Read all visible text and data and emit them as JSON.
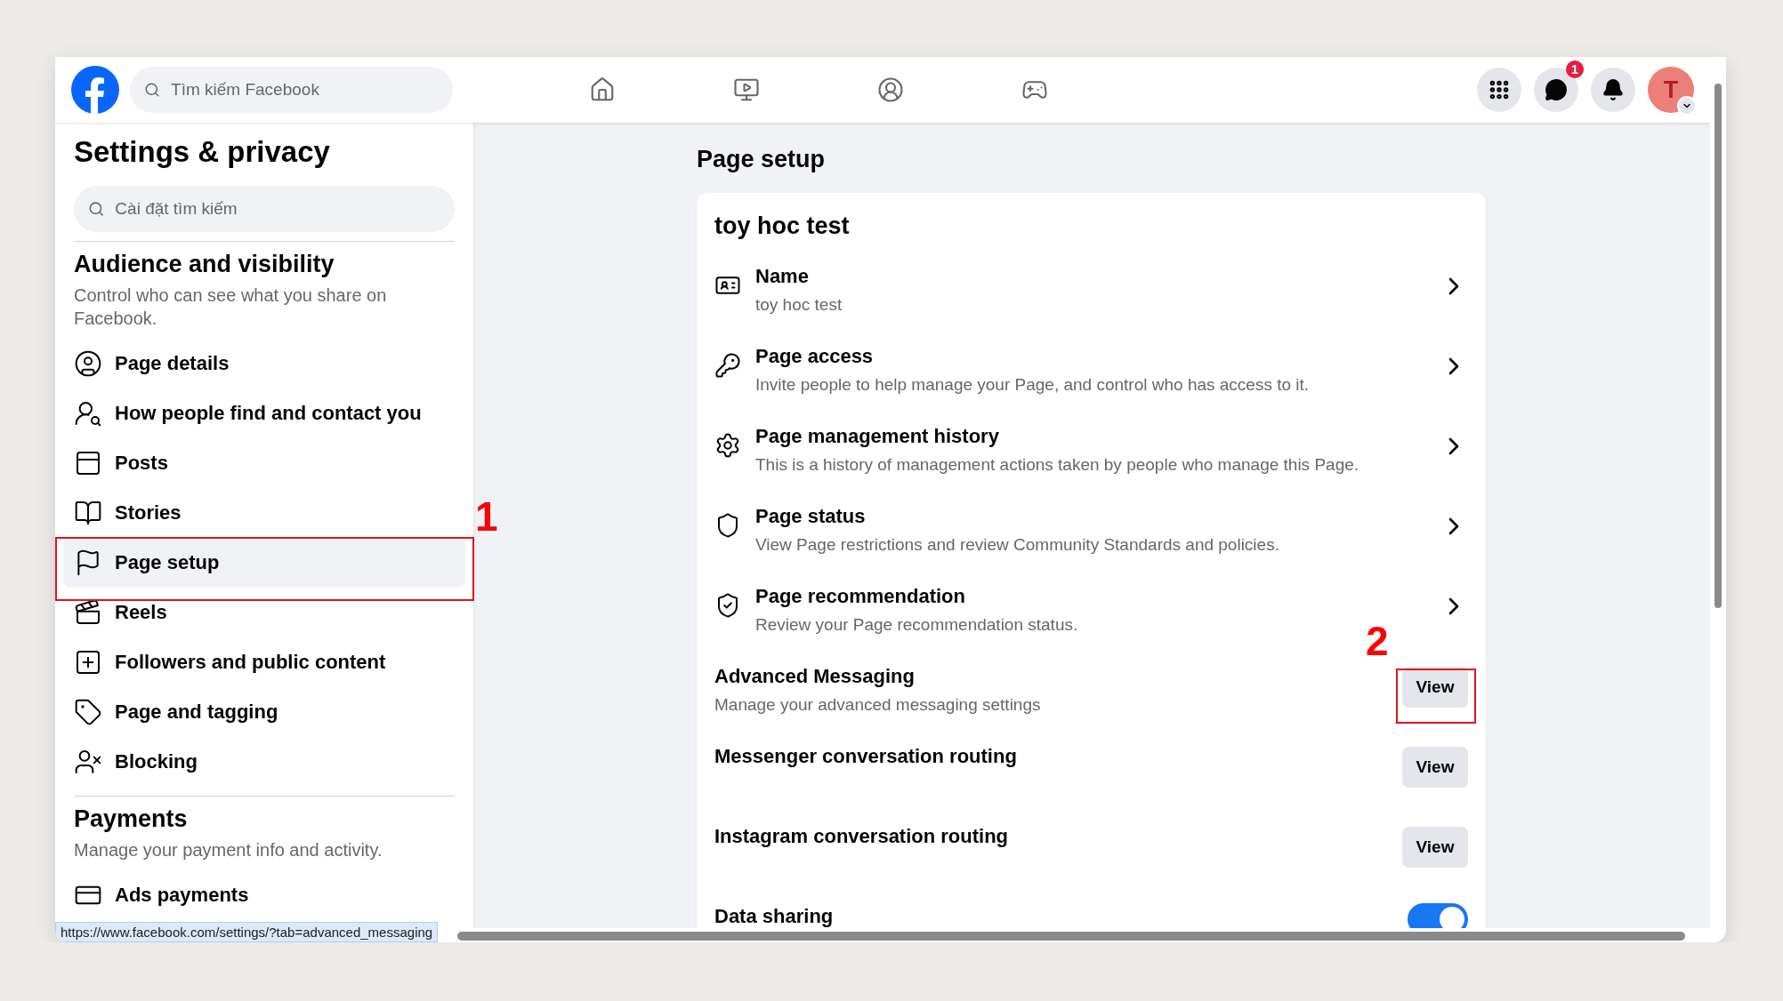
{
  "topbar": {
    "search": {
      "placeholder": "Tìm kiếm Facebook"
    },
    "messenger_badge": "1",
    "avatar_letter": "T"
  },
  "sidebar": {
    "title": "Settings & privacy",
    "search": {
      "placeholder": "Cài đặt tìm kiếm"
    },
    "sections": [
      {
        "heading": "Audience and visibility",
        "description": "Control who can see what you share on Facebook.",
        "items": [
          {
            "label": "Page details",
            "selected": false
          },
          {
            "label": "How people find and contact you",
            "selected": false
          },
          {
            "label": "Posts",
            "selected": false
          },
          {
            "label": "Stories",
            "selected": false
          },
          {
            "label": "Page setup",
            "selected": true
          },
          {
            "label": "Reels",
            "selected": false
          },
          {
            "label": "Followers and public content",
            "selected": false
          },
          {
            "label": "Page and tagging",
            "selected": false
          },
          {
            "label": "Blocking",
            "selected": false
          }
        ]
      },
      {
        "heading": "Payments",
        "description": "Manage your payment info and activity.",
        "items": [
          {
            "label": "Ads payments",
            "selected": false
          }
        ]
      }
    ]
  },
  "main": {
    "title": "Page setup",
    "card": {
      "heading": "toy hoc test",
      "rows": [
        {
          "kind": "link",
          "title": "Name",
          "description": "toy hoc test"
        },
        {
          "kind": "link",
          "title": "Page access",
          "description": "Invite people to help manage your Page, and control who has access to it."
        },
        {
          "kind": "link",
          "title": "Page management history",
          "description": "This is a history of management actions taken by people who manage this Page."
        },
        {
          "kind": "link",
          "title": "Page status",
          "description": "View Page restrictions and review Community Standards and policies."
        },
        {
          "kind": "link",
          "title": "Page recommendation",
          "description": "Review your Page recommendation status."
        },
        {
          "kind": "button",
          "title": "Advanced Messaging",
          "description": "Manage your advanced messaging settings",
          "button": "View"
        },
        {
          "kind": "button",
          "title": "Messenger conversation routing",
          "button": "View"
        },
        {
          "kind": "button",
          "title": "Instagram conversation routing",
          "button": "View"
        },
        {
          "kind": "toggle",
          "title": "Data sharing",
          "on": true
        }
      ]
    }
  },
  "annotations": [
    {
      "label": "1"
    },
    {
      "label": "2"
    }
  ],
  "status_url": "https://www.facebook.com/settings/?tab=advanced_messaging"
}
